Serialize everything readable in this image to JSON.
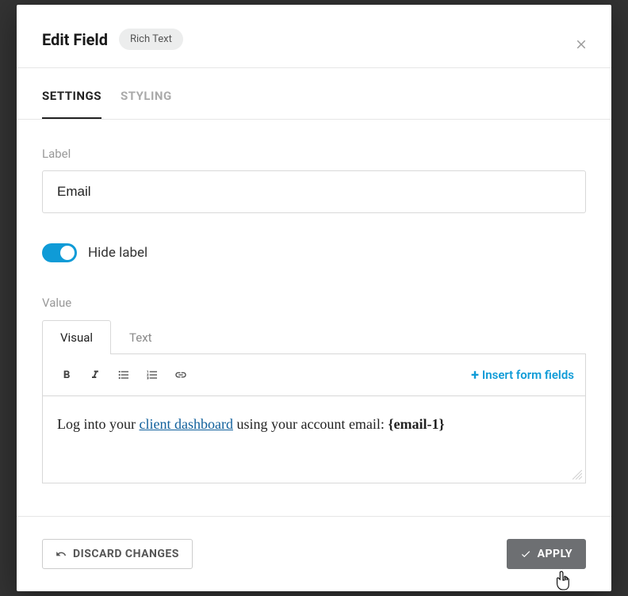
{
  "header": {
    "title": "Edit Field",
    "chip": "Rich Text"
  },
  "tabs": {
    "settings": "SETTINGS",
    "styling": "STYLING"
  },
  "label": {
    "caption": "Label",
    "value": "Email"
  },
  "hide_label": "Hide label",
  "value_section": {
    "caption": "Value",
    "tabs": {
      "visual": "Visual",
      "text": "Text"
    },
    "insert": "Insert form fields",
    "body": {
      "prefix": "Log into your ",
      "link": "client dashboard",
      "middle": " using your account email: ",
      "token": "{email-1}"
    }
  },
  "footer": {
    "discard": "Discard Changes",
    "apply": "Apply"
  }
}
